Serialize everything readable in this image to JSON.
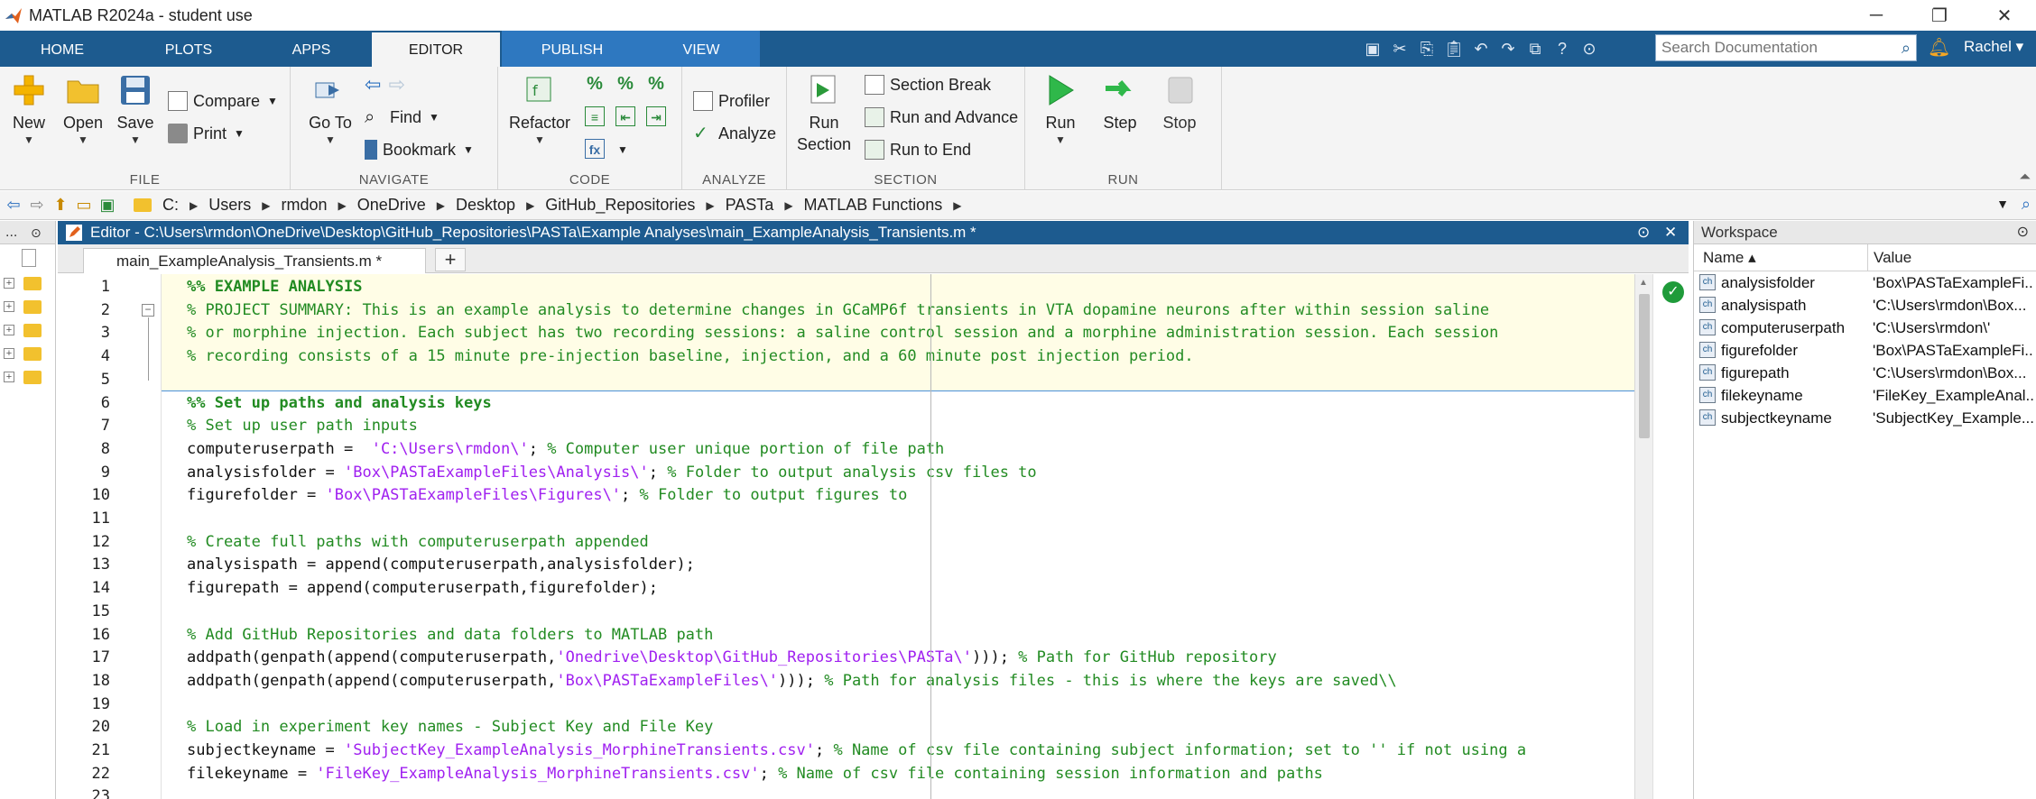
{
  "window": {
    "title": "MATLAB R2024a - student use",
    "minimize": "─",
    "maximize": "❐",
    "close": "✕"
  },
  "tabs": [
    {
      "label": "HOME"
    },
    {
      "label": "PLOTS"
    },
    {
      "label": "APPS"
    },
    {
      "label": "EDITOR"
    },
    {
      "label": "PUBLISH"
    },
    {
      "label": "VIEW"
    }
  ],
  "search": {
    "placeholder": "Search Documentation"
  },
  "user": {
    "name": "Rachel ▾"
  },
  "ribbon": {
    "file": {
      "group": "FILE",
      "new": "New",
      "open": "Open",
      "save": "Save",
      "compare": "Compare",
      "print": "Print"
    },
    "navigate": {
      "group": "NAVIGATE",
      "goto_l1": "Go To",
      "find": "Find",
      "bookmark": "Bookmark"
    },
    "code": {
      "group": "CODE",
      "refactor": "Refactor"
    },
    "analyze": {
      "group": "ANALYZE",
      "profiler": "Profiler",
      "analyze": "Analyze"
    },
    "section": {
      "group": "SECTION",
      "run_section_l1": "Run",
      "run_section_l2": "Section",
      "section_break": "Section Break",
      "run_advance": "Run and Advance",
      "run_end": "Run to End"
    },
    "run": {
      "group": "RUN",
      "run": "Run",
      "step": "Step",
      "stop": "Stop"
    }
  },
  "breadcrumb": [
    "C:",
    "Users",
    "rmdon",
    "OneDrive",
    "Desktop",
    "GitHub_Repositories",
    "PASTa",
    "MATLAB Functions"
  ],
  "leftpanel": {
    "head": "..."
  },
  "editor": {
    "title": "Editor - C:\\Users\\rmdon\\OneDrive\\Desktop\\GitHub_Repositories\\PASTa\\Example Analyses\\main_ExampleAnalysis_Transients.m *",
    "file_tab": "main_ExampleAnalysis_Transients.m *",
    "add_tab": "+"
  },
  "code_lines": [
    {
      "n": "1",
      "segs": [
        [
          "s",
          "%% EXAMPLE ANALYSIS"
        ]
      ]
    },
    {
      "n": "2",
      "segs": [
        [
          "c",
          "% PROJECT SUMMARY: This is an example analysis to determine changes in GCaMP6f transients in VTA dopamine neurons after within session saline"
        ]
      ]
    },
    {
      "n": "3",
      "segs": [
        [
          "c",
          "% or morphine injection. Each subject has two recording sessions: a saline control session and a morphine administration session. Each session"
        ]
      ]
    },
    {
      "n": "4",
      "segs": [
        [
          "c",
          "% recording consists of a 15 minute pre-injection baseline, injection, and a 60 minute post injection period."
        ]
      ]
    },
    {
      "n": "5",
      "segs": []
    },
    {
      "n": "6",
      "segs": [
        [
          "s",
          "%% Set up paths and analysis keys"
        ]
      ]
    },
    {
      "n": "7",
      "segs": [
        [
          "c",
          "% Set up user path inputs"
        ]
      ]
    },
    {
      "n": "8",
      "segs": [
        [
          "k",
          "computeruserpath =  "
        ],
        [
          "t",
          "'C:\\Users\\rmdon\\'"
        ],
        [
          "k",
          "; "
        ],
        [
          "c",
          "% Computer user unique portion of file path"
        ]
      ]
    },
    {
      "n": "9",
      "segs": [
        [
          "k",
          "analysisfolder = "
        ],
        [
          "t",
          "'Box\\PASTaExampleFiles\\Analysis\\'"
        ],
        [
          "k",
          "; "
        ],
        [
          "c",
          "% Folder to output analysis csv files to"
        ]
      ]
    },
    {
      "n": "10",
      "segs": [
        [
          "k",
          "figurefolder = "
        ],
        [
          "t",
          "'Box\\PASTaExampleFiles\\Figures\\'"
        ],
        [
          "k",
          "; "
        ],
        [
          "c",
          "% Folder to output figures to"
        ]
      ]
    },
    {
      "n": "11",
      "segs": []
    },
    {
      "n": "12",
      "segs": [
        [
          "c",
          "% Create full paths with computeruserpath appended"
        ]
      ]
    },
    {
      "n": "13",
      "segs": [
        [
          "k",
          "analysispath = append(computeruserpath,analysisfolder);"
        ]
      ]
    },
    {
      "n": "14",
      "segs": [
        [
          "k",
          "figurepath = append(computeruserpath,figurefolder);"
        ]
      ]
    },
    {
      "n": "15",
      "segs": []
    },
    {
      "n": "16",
      "segs": [
        [
          "c",
          "% Add GitHub Repositories and data folders to MATLAB path"
        ]
      ]
    },
    {
      "n": "17",
      "segs": [
        [
          "k",
          "addpath(genpath(append(computeruserpath,"
        ],
        [
          "t",
          "'Onedrive\\Desktop\\GitHub_Repositories\\PASTa\\'"
        ],
        [
          "k",
          "))); "
        ],
        [
          "c",
          "% Path for GitHub repository"
        ]
      ]
    },
    {
      "n": "18",
      "segs": [
        [
          "k",
          "addpath(genpath(append(computeruserpath,"
        ],
        [
          "t",
          "'Box\\PASTaExampleFiles\\'"
        ],
        [
          "k",
          "))); "
        ],
        [
          "c",
          "% Path for analysis files - this is where the keys are saved\\\\"
        ]
      ]
    },
    {
      "n": "19",
      "segs": []
    },
    {
      "n": "20",
      "segs": [
        [
          "c",
          "% Load in experiment key names - Subject Key and File Key"
        ]
      ]
    },
    {
      "n": "21",
      "segs": [
        [
          "k",
          "subjectkeyname = "
        ],
        [
          "t",
          "'SubjectKey_ExampleAnalysis_MorphineTransients.csv'"
        ],
        [
          "k",
          "; "
        ],
        [
          "c",
          "% Name of csv file containing subject information; set to '' if not using a"
        ]
      ]
    },
    {
      "n": "22",
      "segs": [
        [
          "k",
          "filekeyname = "
        ],
        [
          "t",
          "'FileKey_ExampleAnalysis_MorphineTransients.csv'"
        ],
        [
          "k",
          "; "
        ],
        [
          "c",
          "% Name of csv file containing session information and paths"
        ]
      ]
    },
    {
      "n": "23",
      "segs": []
    }
  ],
  "workspace": {
    "title": "Workspace",
    "col_name": "Name ▴",
    "col_value": "Value",
    "vars": [
      {
        "name": "analysisfolder",
        "value": "'Box\\PASTaExampleFi..."
      },
      {
        "name": "analysispath",
        "value": "'C:\\Users\\rmdon\\Box..."
      },
      {
        "name": "computeruserpath",
        "value": "'C:\\Users\\rmdon\\'"
      },
      {
        "name": "figurefolder",
        "value": "'Box\\PASTaExampleFi..."
      },
      {
        "name": "figurepath",
        "value": "'C:\\Users\\rmdon\\Box..."
      },
      {
        "name": "filekeyname",
        "value": "'FileKey_ExampleAnal..."
      },
      {
        "name": "subjectkeyname",
        "value": "'SubjectKey_Example..."
      }
    ]
  },
  "colors": {
    "accent": "#1d5b8f",
    "comment": "#228b22",
    "string": "#a020f0",
    "ok": "#1f9b3a"
  }
}
